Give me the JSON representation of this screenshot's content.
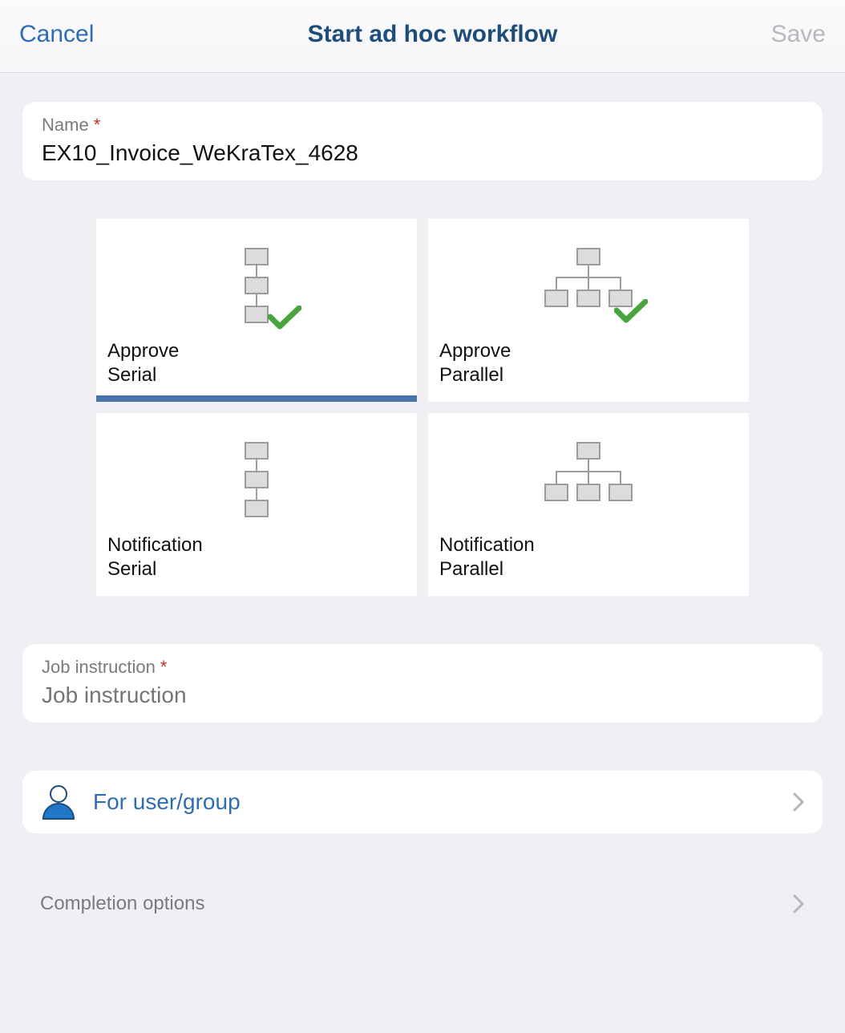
{
  "header": {
    "cancel_label": "Cancel",
    "title": "Start ad hoc workflow",
    "save_label": "Save"
  },
  "name_field": {
    "label": "Name",
    "value": "EX10_Invoice_WeKraTex_4628"
  },
  "tiles": [
    {
      "line1": "Approve",
      "line2": "Serial",
      "icon": "serial-check",
      "selected": true
    },
    {
      "line1": "Approve",
      "line2": "Parallel",
      "icon": "parallel-check",
      "selected": false
    },
    {
      "line1": "Notification",
      "line2": "Serial",
      "icon": "serial",
      "selected": false
    },
    {
      "line1": "Notification",
      "line2": "Parallel",
      "icon": "parallel",
      "selected": false
    }
  ],
  "job_instruction": {
    "label": "Job instruction",
    "placeholder": "Job instruction",
    "value": ""
  },
  "user_row": {
    "label": "For user/group"
  },
  "completion_row": {
    "label": "Completion options"
  },
  "colors": {
    "accent": "#2f6db3",
    "selected_bar": "#4a74a8",
    "check": "#49a63f"
  }
}
